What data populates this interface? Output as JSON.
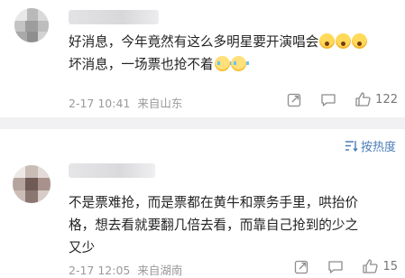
{
  "comments": [
    {
      "lines": [
        "好消息，今年竟然有这么多明星要开演唱会",
        "坏消息，一场票也抢不着"
      ],
      "time": "2-17 10:41",
      "location": "来自山东",
      "likes": "122",
      "icons": [
        "share-icon",
        "comment-icon",
        "like-icon"
      ],
      "emoji_line1": [
        "shocked-emoji",
        "shocked-emoji",
        "shocked-emoji"
      ],
      "emoji_line2": [
        "crying-emoji",
        "crying-emoji"
      ]
    },
    {
      "lines": [
        "不是票难抢，而是票都在黄牛和票务手里，哄抬价",
        "格，想去看就要翻几倍去看，而靠自己抢到的少之",
        "又少"
      ],
      "time": "2-17 12:05",
      "location": "来自湖南",
      "likes": "15",
      "icons": [
        "share-icon",
        "comment-icon",
        "like-icon"
      ]
    }
  ],
  "sort": {
    "label": "按热度",
    "icon": "sort-icon"
  },
  "colors": {
    "accent": "#4a7cb8",
    "meta": "#9a9a9a",
    "divider": "#f1f1f3"
  }
}
